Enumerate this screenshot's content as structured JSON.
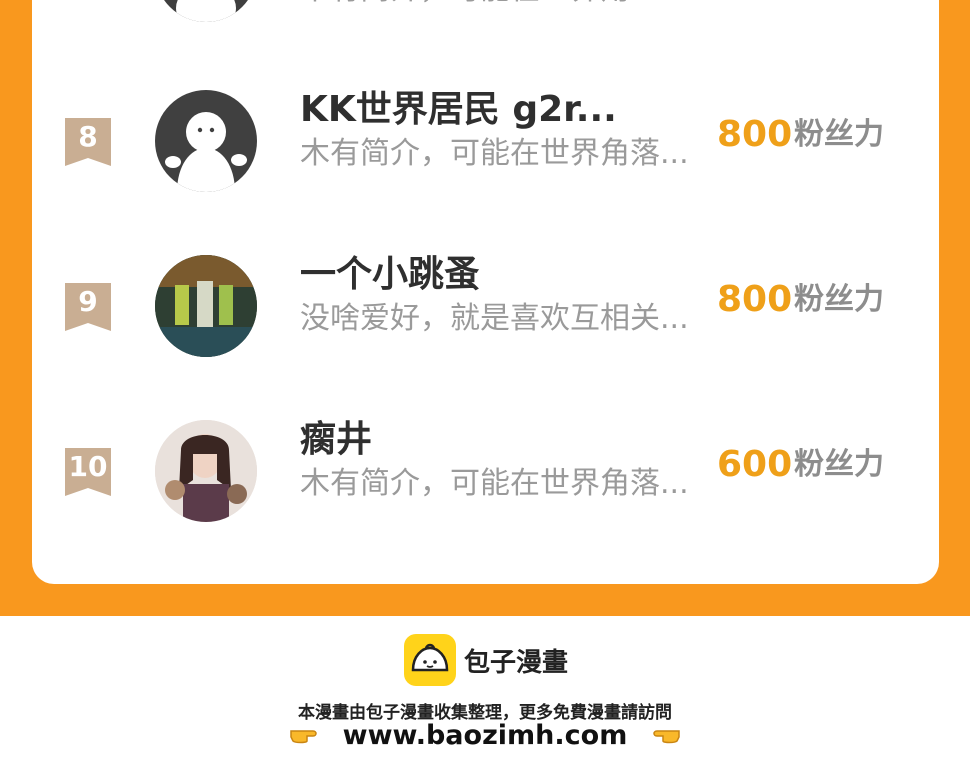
{
  "top_row": {
    "bio": "木有简介，可能在世界角..."
  },
  "ranking": [
    {
      "rank": "8",
      "name": "KK世界居民 g2r...",
      "bio": "木有简介，可能在世界角落...",
      "fans": "800",
      "fans_label": "粉丝力",
      "avatar": "default-avatar"
    },
    {
      "rank": "9",
      "name": "一个小跳蚤",
      "bio": "没啥爱好，就是喜欢互相关...",
      "fans": "800",
      "fans_label": "粉丝力",
      "avatar": "photo-avatar"
    },
    {
      "rank": "10",
      "name": "瘸井",
      "bio": "木有简介，可能在世界角落...",
      "fans": "600",
      "fans_label": "粉丝力",
      "avatar": "photo-avatar"
    }
  ],
  "footer": {
    "logo_text": "包子漫畫",
    "notice": "本漫畫由包子漫畫收集整理，更多免費漫畫請訪問",
    "site": "www.baozimh.com"
  },
  "colors": {
    "orange": "#F9981E",
    "fans_number": "#EFA019",
    "rank_badge": "#C9AE93",
    "logo_yellow": "#FFD31A"
  }
}
